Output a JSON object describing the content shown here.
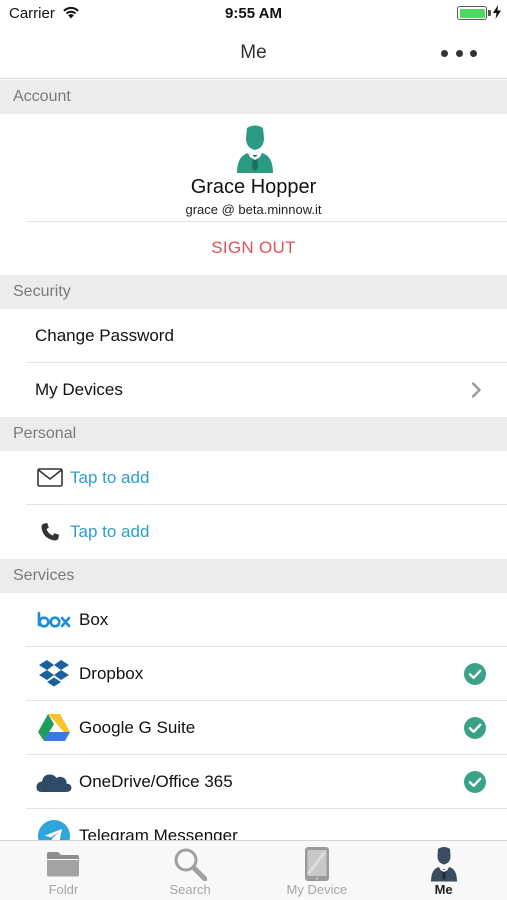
{
  "status_bar": {
    "carrier": "Carrier",
    "time": "9:55 AM",
    "battery_level": 1.0
  },
  "nav": {
    "title": "Me",
    "more_icon": "ellipsis-icon"
  },
  "account": {
    "header": "Account",
    "name": "Grace Hopper",
    "email": "grace @ beta.minnow.it",
    "sign_out": "SIGN OUT"
  },
  "security": {
    "header": "Security",
    "items": [
      {
        "label": "Change Password",
        "chevron": false
      },
      {
        "label": "My Devices",
        "chevron": true
      }
    ]
  },
  "personal": {
    "header": "Personal",
    "items": [
      {
        "icon": "envelope-icon",
        "label": "Tap to add"
      },
      {
        "icon": "phone-icon",
        "label": "Tap to add"
      }
    ]
  },
  "services": {
    "header": "Services",
    "items": [
      {
        "icon": "box-logo",
        "label": "Box",
        "connected": false
      },
      {
        "icon": "dropbox-logo",
        "label": "Dropbox",
        "connected": true
      },
      {
        "icon": "google-drive-logo",
        "label": "Google G Suite",
        "connected": true
      },
      {
        "icon": "onedrive-logo",
        "label": "OneDrive/Office 365",
        "connected": true
      },
      {
        "icon": "telegram-logo",
        "label": "Telegram Messenger",
        "connected": false
      }
    ]
  },
  "tab_bar": {
    "tabs": [
      {
        "label": "Foldr",
        "icon": "folder-icon",
        "active": false
      },
      {
        "label": "Search",
        "icon": "magnifier-icon",
        "active": false
      },
      {
        "label": "My Device",
        "icon": "tablet-icon",
        "active": false
      },
      {
        "label": "Me",
        "icon": "person-icon",
        "active": true
      }
    ]
  },
  "colors": {
    "accent_link": "#2a9fcf",
    "sign_out": "#e2505a",
    "check": "#3aa387",
    "avatar": "#2a9a82"
  }
}
